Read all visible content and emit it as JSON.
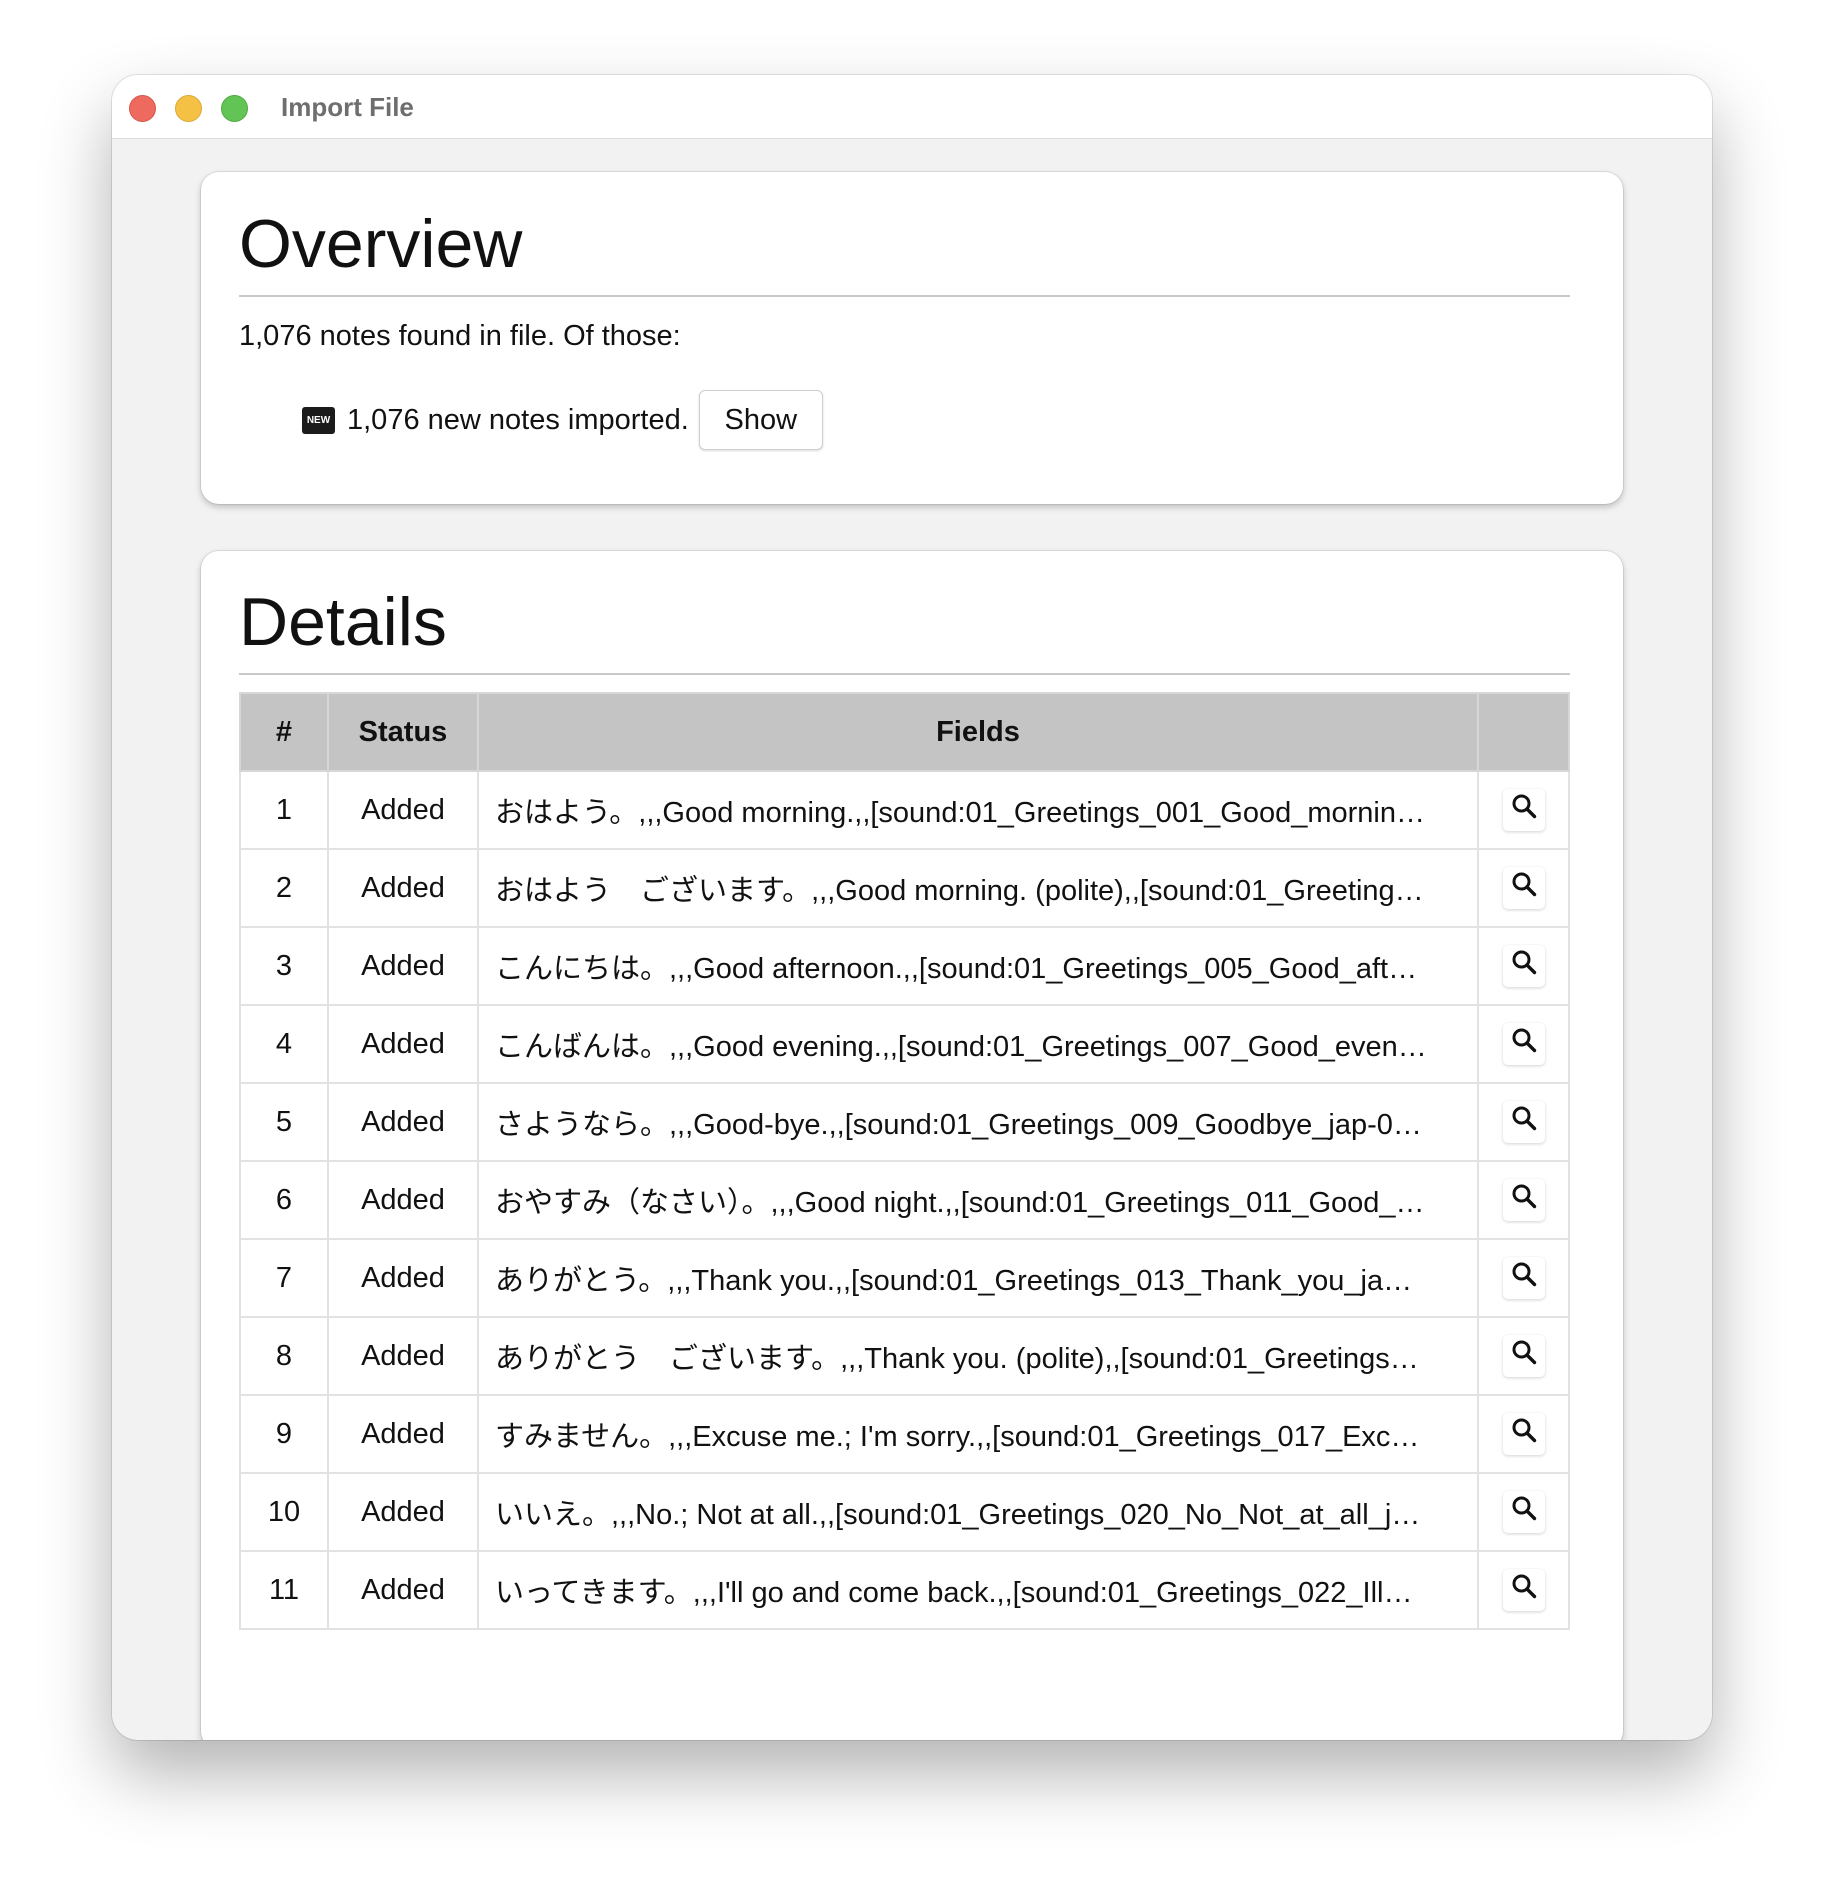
{
  "window": {
    "title": "Import File"
  },
  "overview": {
    "heading": "Overview",
    "summary": "1,076 notes found in file. Of those:",
    "new_badge": "NEW",
    "new_text": "1,076 new notes imported.",
    "show_label": "Show"
  },
  "details": {
    "heading": "Details",
    "columns": [
      "#",
      "Status",
      "Fields",
      ""
    ],
    "rows": [
      {
        "num": "1",
        "status": "Added",
        "fields": "おはよう。,,,Good morning.,,[sound:01_Greetings_001_Good_mornin…"
      },
      {
        "num": "2",
        "status": "Added",
        "fields": "おはよう　ございます。,,,Good morning. (polite),,[sound:01_Greeting…"
      },
      {
        "num": "3",
        "status": "Added",
        "fields": "こんにちは。,,,Good afternoon.,,[sound:01_Greetings_005_Good_aft…"
      },
      {
        "num": "4",
        "status": "Added",
        "fields": "こんばんは。,,,Good evening.,,[sound:01_Greetings_007_Good_even…"
      },
      {
        "num": "5",
        "status": "Added",
        "fields": "さようなら。,,,Good-bye.,,[sound:01_Greetings_009_Goodbye_jap-0…"
      },
      {
        "num": "6",
        "status": "Added",
        "fields": "おやすみ（なさい）。,,,Good night.,,[sound:01_Greetings_011_Good_…"
      },
      {
        "num": "7",
        "status": "Added",
        "fields": "ありがとう。,,,Thank you.,,[sound:01_Greetings_013_Thank_you_ja…"
      },
      {
        "num": "8",
        "status": "Added",
        "fields": "ありがとう　ございます。,,,Thank you. (polite),,[sound:01_Greetings…"
      },
      {
        "num": "9",
        "status": "Added",
        "fields": "すみません。,,,Excuse me.; I'm sorry.,,[sound:01_Greetings_017_Exc…"
      },
      {
        "num": "10",
        "status": "Added",
        "fields": "いいえ。,,,No.; Not at all.,,[sound:01_Greetings_020_No_Not_at_all_j…"
      },
      {
        "num": "11",
        "status": "Added",
        "fields": "いってきます。,,,I'll go and come back.,,[sound:01_Greetings_022_Ill…"
      }
    ],
    "row_action_icon": "search-icon"
  },
  "colors": {
    "close": "#ee6a5f",
    "minimize": "#f5c144",
    "maximize": "#61c454",
    "header_bg": "#c4c4c4",
    "window_bg": "#f2f2f2"
  }
}
